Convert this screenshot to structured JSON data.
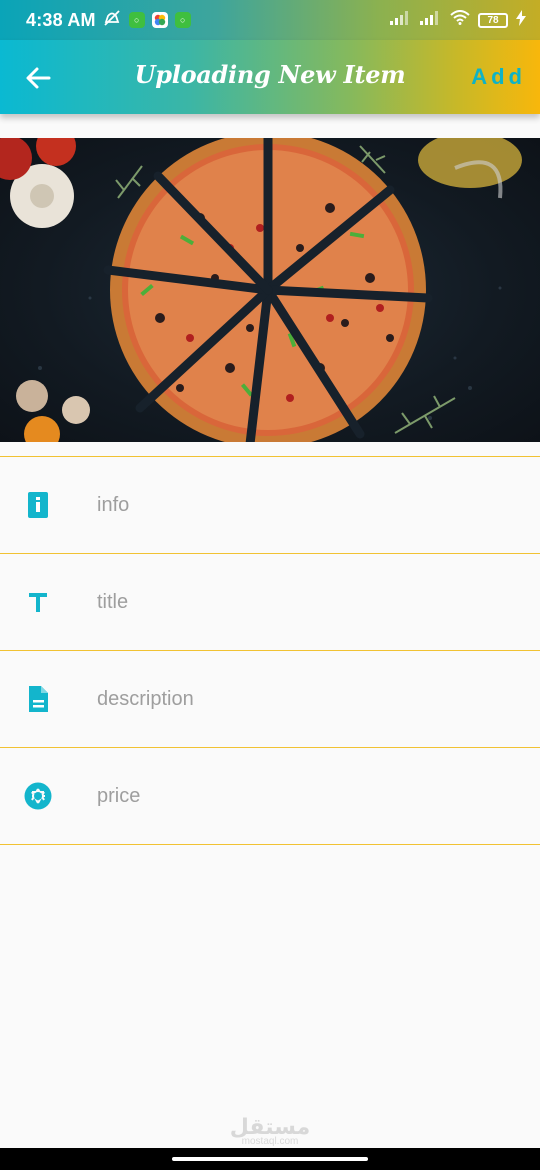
{
  "status_bar": {
    "time": "4:38 AM",
    "battery": "78",
    "icons": [
      "mute-icon",
      "chat-notification-icon",
      "gallery-icon",
      "chat-notification-icon",
      "signal-icon",
      "signal-icon",
      "wifi-icon",
      "battery-icon",
      "charging-icon"
    ]
  },
  "app_bar": {
    "title": "Uploading New Item",
    "add_label": "Add",
    "back_icon": "arrow-back-icon"
  },
  "image": {
    "description_icon": "pizza-photo"
  },
  "form": {
    "fields": [
      {
        "placeholder": "info",
        "icon": "info-icon",
        "value": ""
      },
      {
        "placeholder": "title",
        "icon": "title-icon",
        "value": ""
      },
      {
        "placeholder": "description",
        "icon": "description-icon",
        "value": ""
      },
      {
        "placeholder": "price",
        "icon": "camera-shutter-icon",
        "value": ""
      }
    ]
  },
  "colors": {
    "accent": "#13b5cc",
    "divider": "#f1c232",
    "gradient_start": "#0ab9d2",
    "gradient_end": "#f8b70b"
  },
  "watermark": {
    "text": "مستقل",
    "sub": "mostaql.com"
  }
}
